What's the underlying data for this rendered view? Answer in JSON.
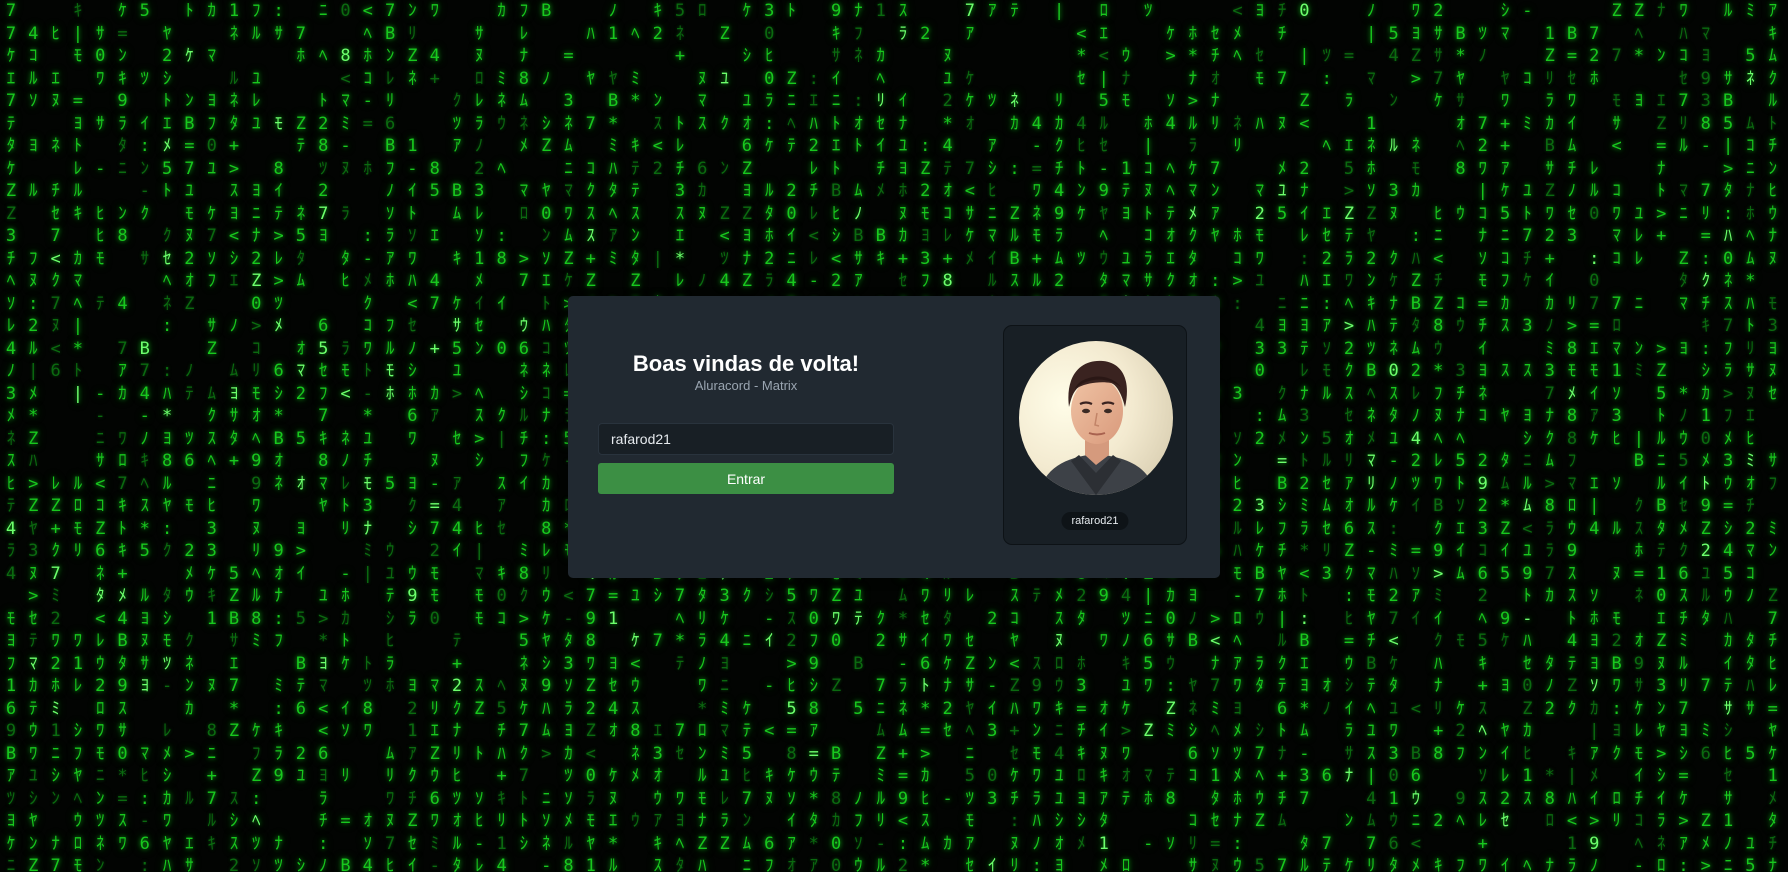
{
  "background": {
    "theme": "matrix-digital-rain",
    "rain_color": "#18c81e",
    "base_color": "#020402"
  },
  "login": {
    "title": "Boas vindas de volta!",
    "subtitle": "Aluracord - Matrix",
    "username_value": "rafarod21",
    "submit_label": "Entrar"
  },
  "profile": {
    "username": "rafarod21",
    "avatar": "user-photo"
  },
  "colors": {
    "card": "#212931",
    "panel": "#181f25",
    "button": "#3c8f44",
    "text": "#ffffff",
    "muted": "#9aa5b1"
  }
}
